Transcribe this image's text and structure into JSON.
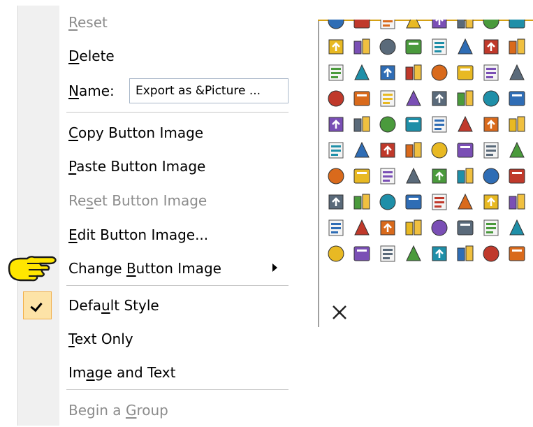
{
  "menu": {
    "items": [
      {
        "id": "reset",
        "label": "Reset",
        "underline": "R",
        "disabled": true
      },
      {
        "id": "delete",
        "label": "Delete",
        "underline": "D",
        "disabled": false
      },
      {
        "id": "name",
        "label": "Name:",
        "underline": "N",
        "value": "Export as &Picture ..."
      },
      {
        "id": "copy",
        "label": "Copy Button Image",
        "underline": "C",
        "disabled": false
      },
      {
        "id": "paste",
        "label": "Paste Button Image",
        "underline": "P",
        "disabled": false
      },
      {
        "id": "reset-image",
        "label": "Reset Button Image",
        "underline": "s",
        "disabled": true
      },
      {
        "id": "edit",
        "label": "Edit Button Image...",
        "underline": "E",
        "disabled": false
      },
      {
        "id": "change",
        "label": "Change Button Image",
        "underline": "B",
        "disabled": false,
        "submenu": true
      },
      {
        "id": "default",
        "label": "Default Style",
        "underline": "u",
        "disabled": false,
        "checked": true
      },
      {
        "id": "text-only",
        "label": "Text Only",
        "underline": "T",
        "disabled": false
      },
      {
        "id": "image-text",
        "label": "Image and Text",
        "underline": "a",
        "disabled": false
      },
      {
        "id": "group",
        "label": "Begin a Group",
        "underline": "G",
        "disabled": true
      }
    ]
  },
  "palette": {
    "icons": [
      "globe-icon",
      "book-icon",
      "list-icon",
      "paperclip-icon",
      "shield-icon",
      "chart-icon",
      "book2-icon",
      "envelope-icon",
      "open-book-icon",
      "green-book-icon",
      "green-book2-icon",
      "hand-icon",
      "calculator-icon",
      "calendar-icon",
      "grid-icon",
      "network-icon",
      "form-icon",
      "note-icon",
      "spell-check-icon",
      "palette-icon",
      "phone-icon",
      "color-swatch-icon",
      "arrows-icon",
      "arrows2-icon",
      "gradient-icon",
      "textbox-icon",
      "spacing-icon",
      "arrow-down-icon",
      "arrow-left-icon",
      "arrow-right-icon",
      "arrow-up-icon",
      "filter-icon",
      "binoculars-icon",
      "binoculars2-icon",
      "flag-green-icon",
      "flag-red-icon",
      "font-a-icon",
      "font-a2-icon",
      "function-icon",
      "italic-icon",
      "shortcut-icon",
      "bar-chart-icon",
      "help-icon",
      "text-abc-icon",
      "home-icon",
      "document-icon",
      "plant-icon",
      "document2-icon",
      "pie-chart-icon",
      "cursor-icon",
      "camera-icon",
      "book-pink-icon",
      "folder-open-icon",
      "pin-icon",
      "refresh-icon",
      "page-icon",
      "database-icon",
      "save-icon",
      "table-grid-icon",
      "table-icon",
      "list-view-icon",
      "exchange-icon",
      "omega-icon",
      "image-icon",
      "horizontal-lines-icon",
      "warning-icon",
      "search-icon",
      "stack-icon",
      "lock-icon",
      "numbered-list-icon",
      "bullet-list-icon",
      "window-icon",
      "keyboard-icon",
      "disc-icon",
      "clipboard-icon",
      "clock-icon",
      "cylinder-icon",
      "gear-icon",
      "gears-icon",
      "tool-icon"
    ],
    "close_glyph": "✕"
  }
}
